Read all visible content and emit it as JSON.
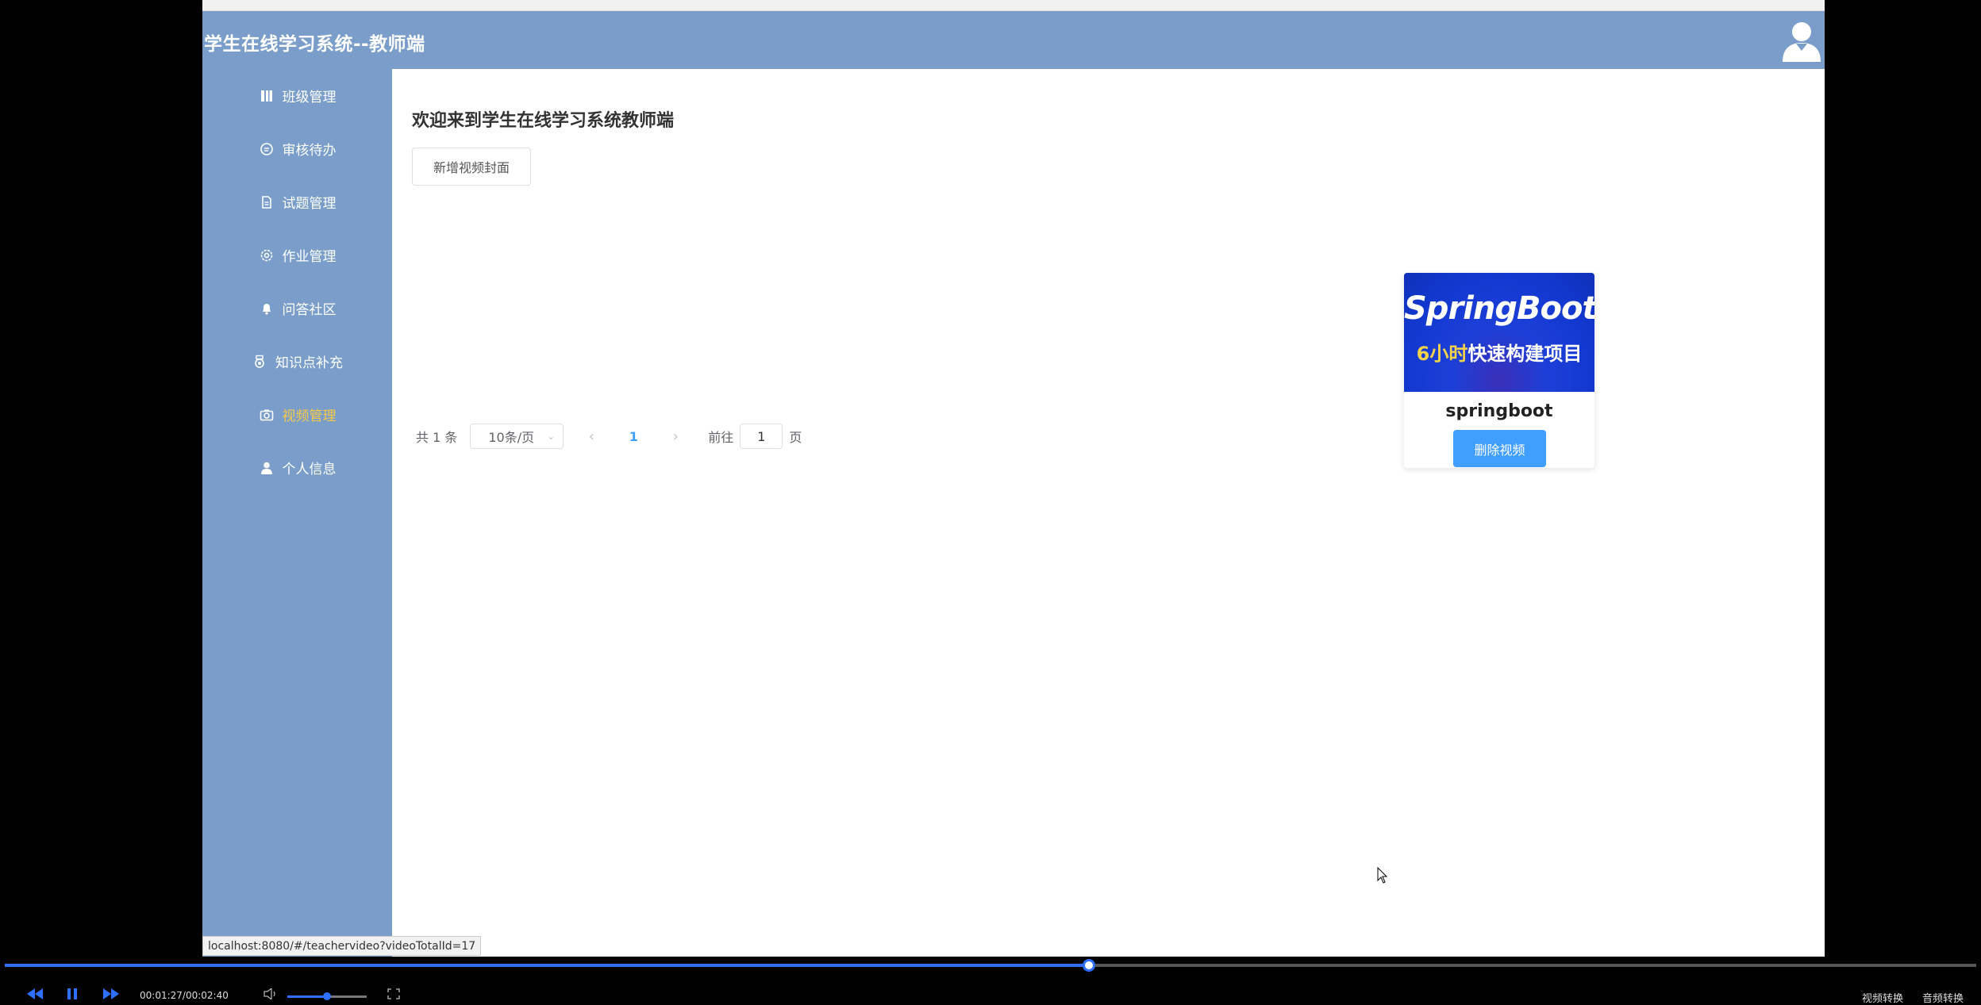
{
  "header": {
    "title": "学生在线学习系统--教师端",
    "avatar_icon": "user-avatar-icon"
  },
  "sidebar": {
    "items": [
      {
        "label": "班级管理",
        "icon": "class-book-icon",
        "active": false
      },
      {
        "label": "审核待办",
        "icon": "chat-bubble-icon",
        "active": false
      },
      {
        "label": "试题管理",
        "icon": "document-icon",
        "active": false
      },
      {
        "label": "作业管理",
        "icon": "gear-icon",
        "active": false
      },
      {
        "label": "问答社区",
        "icon": "bell-icon",
        "active": false
      },
      {
        "label": "知识点补充",
        "icon": "medal-icon",
        "active": false
      },
      {
        "label": "视频管理",
        "icon": "camera-icon",
        "active": true
      },
      {
        "label": "个人信息",
        "icon": "person-icon",
        "active": false
      }
    ]
  },
  "main": {
    "welcome": "欢迎来到学生在线学习系统教师端",
    "add_button": "新增视频封面",
    "cards": [
      {
        "thumb_line1": "SpringBoot",
        "thumb_line2_highlight": "6小时",
        "thumb_line2_rest": "快速构建项目",
        "name": "springboot",
        "delete_button": "删除视频"
      }
    ],
    "pagination": {
      "total": "共 1 条",
      "page_size": "10条/页",
      "current_page": "1",
      "goto_label": "前往",
      "goto_value": "1",
      "goto_suffix": "页"
    }
  },
  "status_bar_url": "localhost:8080/#/teachervideo?videoTotalId=17",
  "player": {
    "time": "00:01:27/00:02:40",
    "progress_fraction": 0.55,
    "volume_fraction": 0.5,
    "right_label_1": "视频转换",
    "right_label_2": "音频转换"
  },
  "colors": {
    "sidebar": "#7a9ec9",
    "accent": "#409eff",
    "active_menu": "#f7c948",
    "player_accent": "#2f6fff"
  }
}
